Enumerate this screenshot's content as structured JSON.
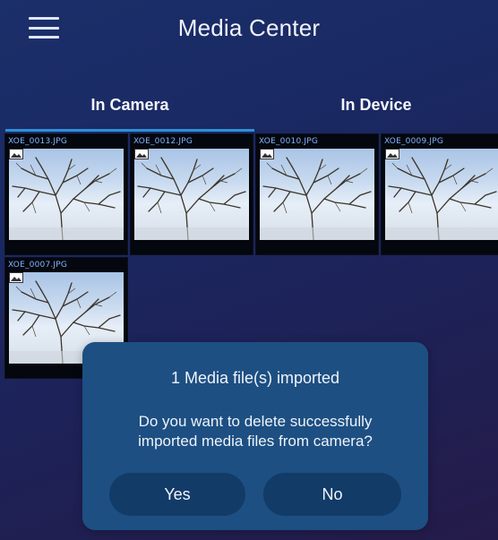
{
  "header": {
    "title": "Media Center",
    "menu_icon": "hamburger-menu-icon"
  },
  "tabs": [
    {
      "label": "In Camera",
      "selected": true
    },
    {
      "label": "In Device",
      "selected": false
    }
  ],
  "media": [
    {
      "name": "XOE_0013.JPG"
    },
    {
      "name": "XOE_0012.JPG"
    },
    {
      "name": "XOE_0010.JPG"
    },
    {
      "name": "XOE_0009.JPG"
    },
    {
      "name": "XOE_0007.JPG"
    }
  ],
  "dialog": {
    "title": "1 Media file(s) imported",
    "message_line1": "Do you want to delete successfully",
    "message_line2": "imported media files from camera?",
    "yes_label": "Yes",
    "no_label": "No"
  },
  "colors": {
    "accent": "#2f8fd6",
    "dialog_bg": "#1d4f82",
    "button_bg": "#123b68",
    "filename_text": "#7fb5ff"
  }
}
